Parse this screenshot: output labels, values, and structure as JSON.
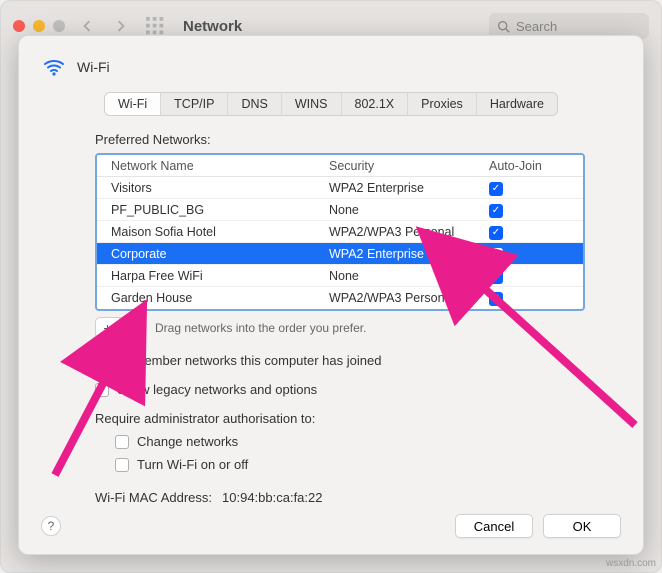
{
  "window": {
    "title": "Network",
    "searchPlaceholder": "Search"
  },
  "sheet": {
    "header": "Wi-Fi",
    "tabs": [
      "Wi-Fi",
      "TCP/IP",
      "DNS",
      "WINS",
      "802.1X",
      "Proxies",
      "Hardware"
    ],
    "activeTab": 0,
    "preferredLabel": "Preferred Networks:",
    "columns": {
      "name": "Network Name",
      "security": "Security",
      "autojoin": "Auto-Join"
    },
    "networks": [
      {
        "name": "Visitors",
        "security": "WPA2 Enterprise",
        "autojoin": true,
        "selected": false
      },
      {
        "name": "PF_PUBLIC_BG",
        "security": "None",
        "autojoin": true,
        "selected": false
      },
      {
        "name": "Maison Sofia Hotel",
        "security": "WPA2/WPA3 Personal",
        "autojoin": true,
        "selected": false
      },
      {
        "name": "Corporate",
        "security": "WPA2 Enterprise",
        "autojoin": true,
        "selected": true
      },
      {
        "name": "Harpa Free WiFi",
        "security": "None",
        "autojoin": true,
        "selected": false
      },
      {
        "name": "Garden House",
        "security": "WPA2/WPA3 Personal",
        "autojoin": true,
        "selected": false
      }
    ],
    "dragHint": "Drag networks into the order you prefer.",
    "remember": {
      "label": "Remember networks this computer has joined",
      "checked": true
    },
    "legacy": {
      "label": "Show legacy networks and options",
      "checked": false
    },
    "adminLabel": "Require administrator authorisation to:",
    "adminOpts": [
      {
        "label": "Change networks",
        "checked": false
      },
      {
        "label": "Turn Wi-Fi on or off",
        "checked": false
      }
    ],
    "mac": {
      "label": "Wi-Fi MAC Address:",
      "value": "10:94:bb:ca:fa:22"
    },
    "buttons": {
      "cancel": "Cancel",
      "ok": "OK"
    }
  },
  "watermark": "wsxdn.com"
}
